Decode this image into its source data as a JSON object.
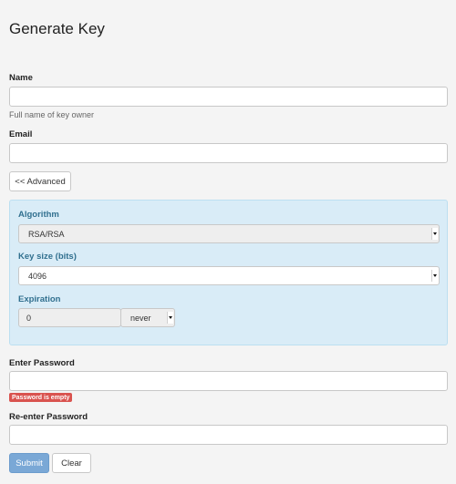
{
  "page": {
    "title": "Generate Key"
  },
  "form": {
    "name": {
      "label": "Name",
      "value": "",
      "hint": "Full name of key owner"
    },
    "email": {
      "label": "Email",
      "value": ""
    },
    "advanced_button": "<< Advanced",
    "advanced": {
      "algorithm": {
        "label": "Algorithm",
        "value": "RSA/RSA"
      },
      "key_size": {
        "label": "Key size (bits)",
        "value": "4096"
      },
      "expiration": {
        "label": "Expiration",
        "value": "0",
        "unit": "never"
      }
    },
    "password": {
      "label": "Enter Password",
      "value": "",
      "error": "Password is empty"
    },
    "password_confirm": {
      "label": "Re-enter Password",
      "value": ""
    },
    "submit": "Submit",
    "clear": "Clear"
  },
  "colors": {
    "panel_bg": "#d9ecf7",
    "panel_label": "#31708f",
    "error": "#d9534f",
    "submit": "#7aa8d6"
  }
}
